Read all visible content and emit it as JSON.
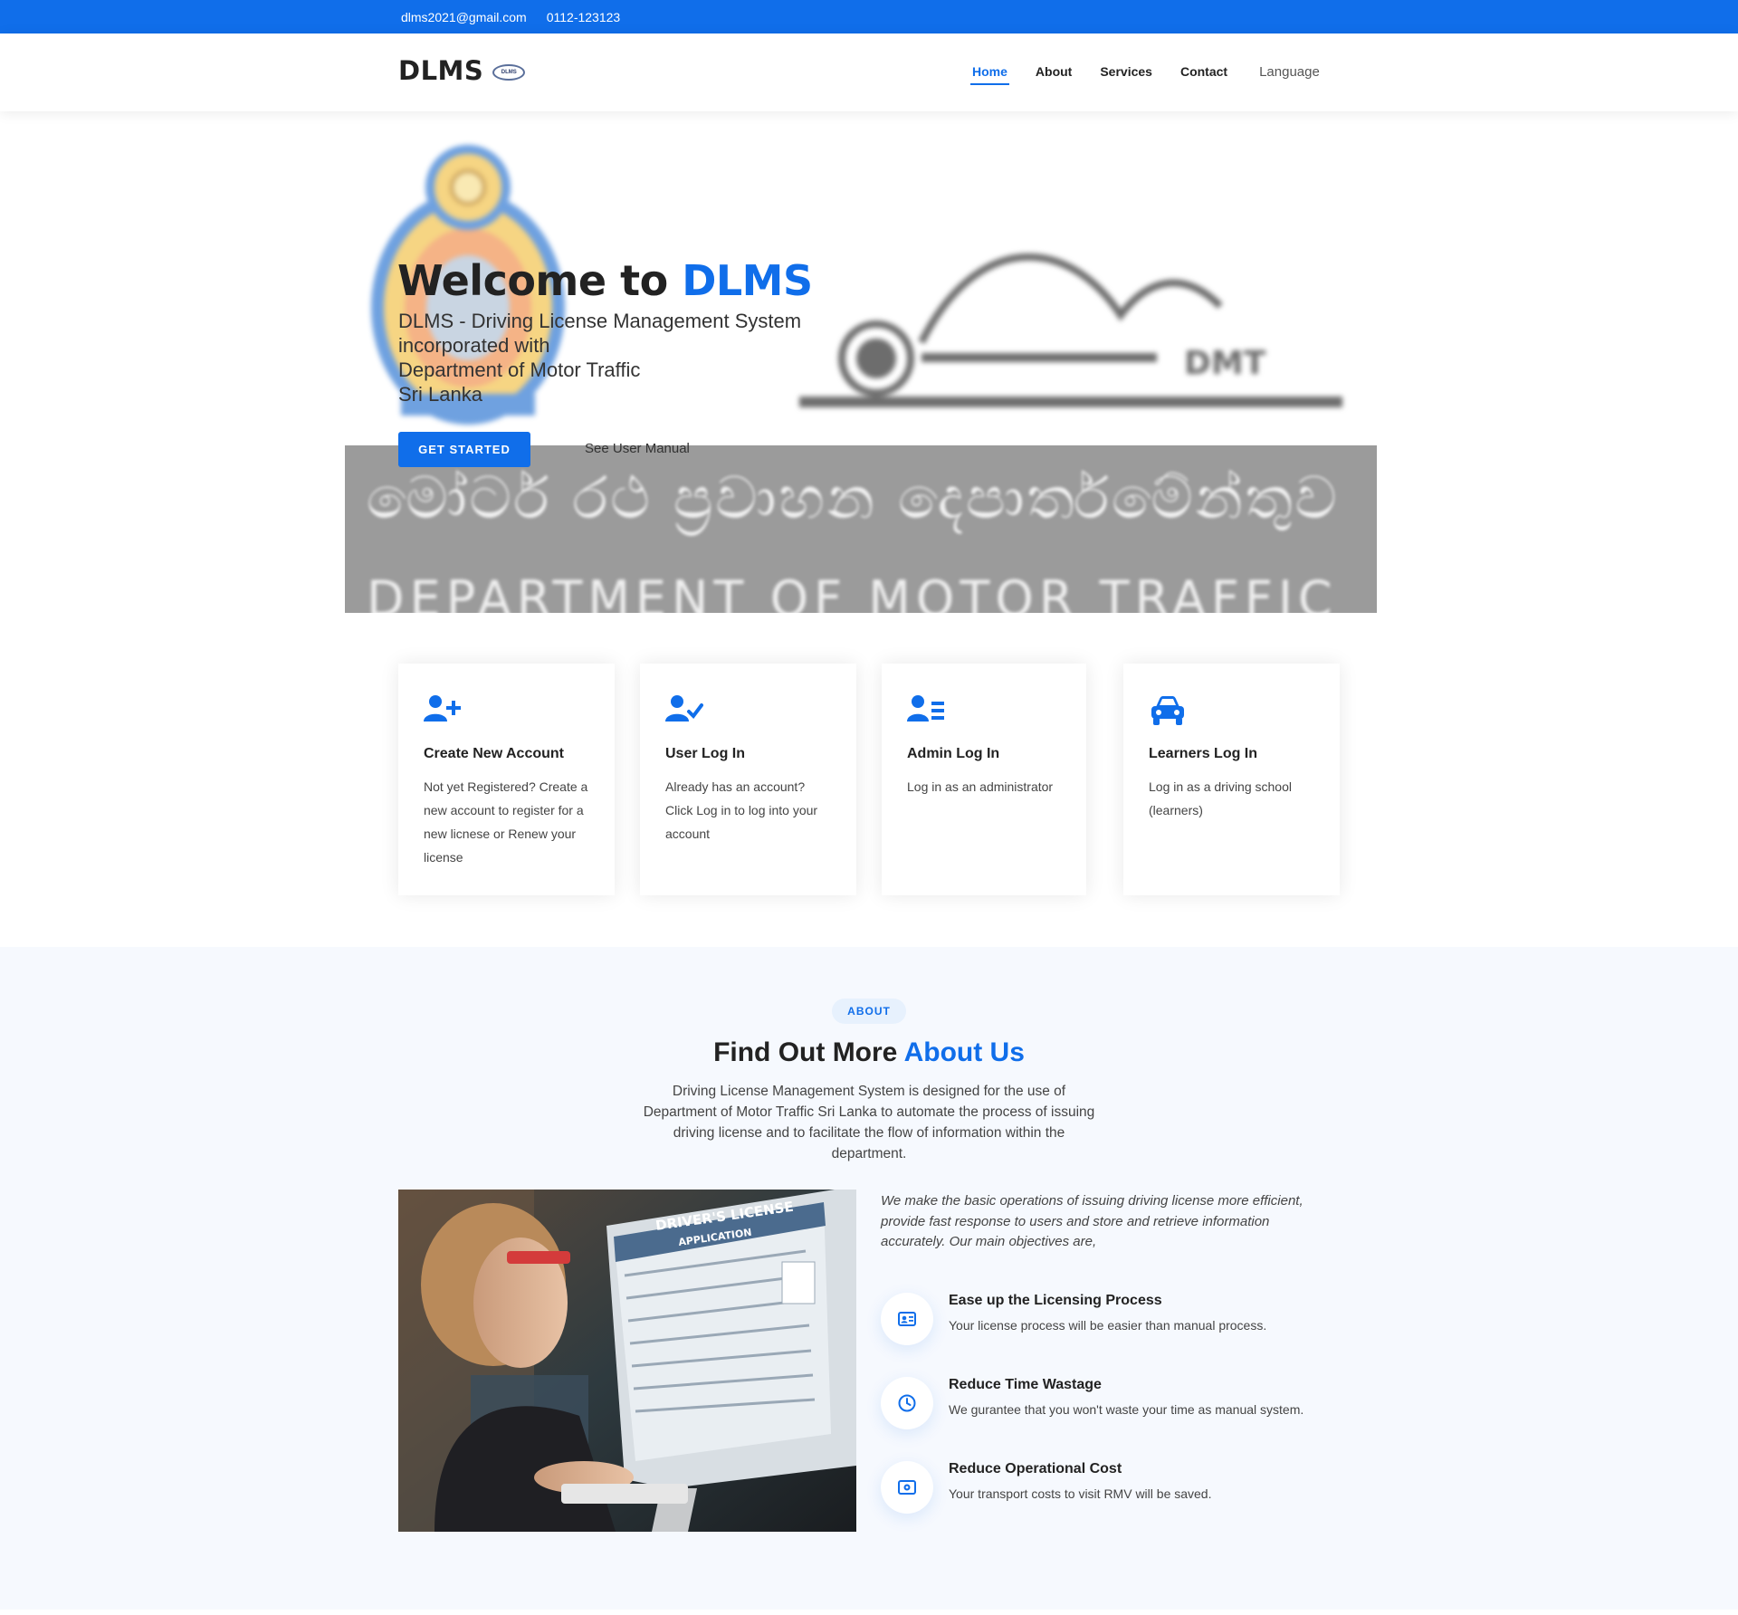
{
  "topbar": {
    "email": "dlms2021@gmail.com",
    "phone": "0112-123123"
  },
  "header": {
    "logo_text": "DLMS",
    "logo_badge_text": "DLMS",
    "nav": [
      {
        "label": "Home",
        "active": true
      },
      {
        "label": "About"
      },
      {
        "label": "Services"
      },
      {
        "label": "Contact"
      }
    ],
    "language_label": "Language"
  },
  "hero": {
    "title_prefix": "Welcome to ",
    "title_accent": "DLMS",
    "subtitle_lines": [
      "DLMS - Driving License Management System",
      "incorporated with",
      "Department of Motor Traffic",
      "Sri Lanka"
    ],
    "get_started_label": "GET STARTED",
    "manual_label": "See User Manual",
    "banner_sinhala": "මෝටර් රථ ප්‍රවාහන දෙපාර්තමේන්තුව",
    "banner_english": "DEPARTMENT OF MOTOR TRAFFIC",
    "dmt_logo_text": "DMT"
  },
  "cards": [
    {
      "icon": "user-plus-icon",
      "title": "Create New Account",
      "desc": "Not yet Registered? Create a new account to register for a new licnese or Renew your license"
    },
    {
      "icon": "user-check-icon",
      "title": "User Log In",
      "desc": "Already has an account? Click Log in to log into your account"
    },
    {
      "icon": "user-list-icon",
      "title": "Admin Log In",
      "desc": "Log in as an administrator"
    },
    {
      "icon": "car-icon",
      "title": "Learners Log In",
      "desc": "Log in as a driving school (learners)"
    }
  ],
  "about": {
    "pill": "ABOUT",
    "title_prefix": "Find Out More ",
    "title_accent": "About Us",
    "description": "Driving License Management System is designed for the use of Department of Motor Traffic Sri Lanka to automate the process of issuing driving license and to facilitate the flow of information within the department.",
    "intro": "We make the basic operations of issuing driving license more efficient, provide fast response to users and store and retrieve information accurately. Our main objectives are,",
    "photo_heading": "DRIVER'S LICENSE",
    "photo_subheading": "APPLICATION",
    "objectives": [
      {
        "icon": "id-card-icon",
        "title": "Ease up the Licensing Process",
        "desc": "Your license process will be easier than manual process."
      },
      {
        "icon": "clock-icon",
        "title": "Reduce Time Wastage",
        "desc": "We gurantee that you won't waste your time as manual system."
      },
      {
        "icon": "money-icon",
        "title": "Reduce Operational Cost",
        "desc": "Your transport costs to visit RMV will be saved."
      }
    ]
  },
  "colors": {
    "accent": "#106eea",
    "about_bg": "#f6f9fe",
    "banner_gray": "#9b9b9b"
  }
}
